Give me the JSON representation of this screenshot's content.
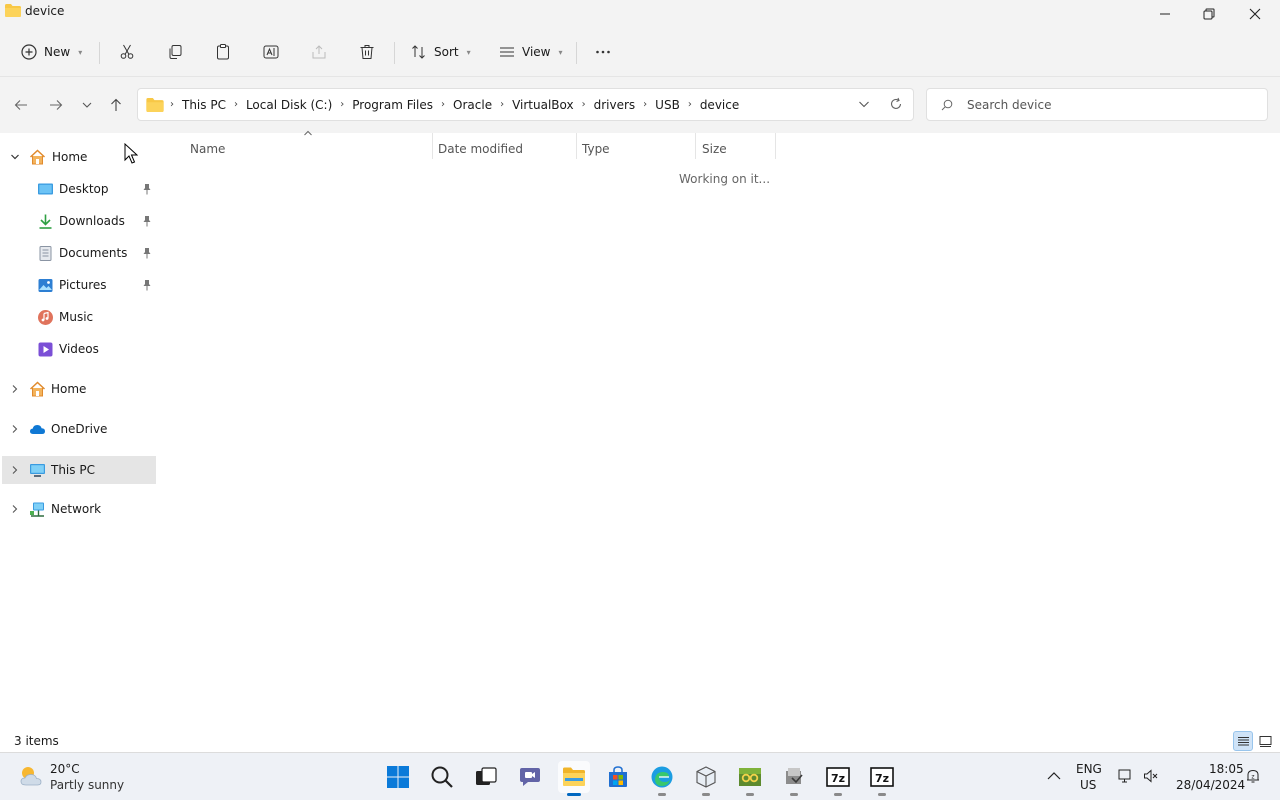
{
  "window": {
    "title": "device"
  },
  "toolbar": {
    "new_label": "New",
    "sort_label": "Sort",
    "view_label": "View"
  },
  "breadcrumbs": [
    "This PC",
    "Local Disk (C:)",
    "Program Files",
    "Oracle",
    "VirtualBox",
    "drivers",
    "USB",
    "device"
  ],
  "search": {
    "placeholder": "Search device"
  },
  "nav": {
    "quick_access": [
      {
        "label": "Home"
      },
      {
        "label": "Desktop"
      },
      {
        "label": "Downloads"
      },
      {
        "label": "Documents"
      },
      {
        "label": "Pictures"
      },
      {
        "label": "Music"
      },
      {
        "label": "Videos"
      }
    ],
    "roots": [
      {
        "label": "Home"
      },
      {
        "label": "OneDrive"
      },
      {
        "label": "This PC"
      },
      {
        "label": "Network"
      }
    ]
  },
  "columns": {
    "name": "Name",
    "date": "Date modified",
    "type": "Type",
    "size": "Size"
  },
  "content": {
    "status": "Working on it..."
  },
  "statusbar": {
    "items": "3 items"
  },
  "taskbar": {
    "weather_temp": "20°C",
    "weather_desc": "Partly sunny",
    "lang_line1": "ENG",
    "lang_line2": "US",
    "time": "18:05",
    "date": "28/04/2024",
    "app_7zip_label": "7z"
  },
  "colors": {
    "accent": "#0067c0",
    "folder": "#f8c846",
    "selected": "#e5e5e5"
  }
}
